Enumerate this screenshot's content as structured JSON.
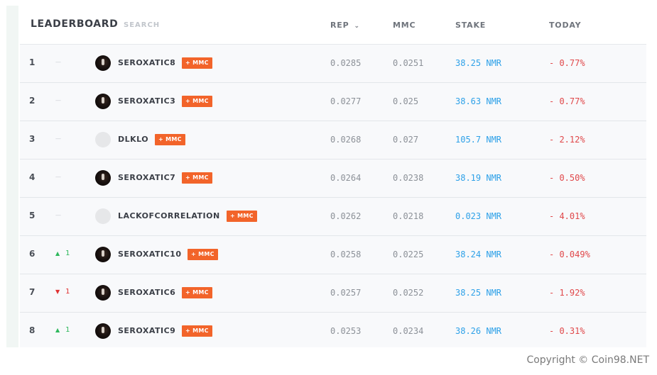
{
  "header": {
    "title": "LEADERBOARD",
    "search_placeholder": "SEARCH",
    "columns": {
      "rep": "REP",
      "mmc": "MMC",
      "stake": "STAKE",
      "today": "TODAY"
    },
    "sort_icon": "chevron-down-icon"
  },
  "colors": {
    "badge": "#f2642a",
    "stake": "#2ea1e8",
    "today_negative": "#e0484a",
    "rank_up": "#2eb85c",
    "rank_down": "#e03131"
  },
  "rows": [
    {
      "rank": "1",
      "move": "—",
      "move_dir": "none",
      "move_num": "",
      "avatar": "dark",
      "name": "SEROXATIC8",
      "badge": "+ MMC",
      "rep": "0.0285",
      "mmc": "0.0251",
      "stake": "38.25 NMR",
      "today": "- 0.77%"
    },
    {
      "rank": "2",
      "move": "—",
      "move_dir": "none",
      "move_num": "",
      "avatar": "dark",
      "name": "SEROXATIC3",
      "badge": "+ MMC",
      "rep": "0.0277",
      "mmc": "0.025",
      "stake": "38.63 NMR",
      "today": "- 0.77%"
    },
    {
      "rank": "3",
      "move": "—",
      "move_dir": "none",
      "move_num": "",
      "avatar": "light",
      "name": "DLKLO",
      "badge": "+ MMC",
      "rep": "0.0268",
      "mmc": "0.027",
      "stake": "105.7 NMR",
      "today": "- 2.12%"
    },
    {
      "rank": "4",
      "move": "—",
      "move_dir": "none",
      "move_num": "",
      "avatar": "dark",
      "name": "SEROXATIC7",
      "badge": "+ MMC",
      "rep": "0.0264",
      "mmc": "0.0238",
      "stake": "38.19 NMR",
      "today": "- 0.50%"
    },
    {
      "rank": "5",
      "move": "—",
      "move_dir": "none",
      "move_num": "",
      "avatar": "light",
      "name": "LACKOFCORRELATION",
      "badge": "+ MMC",
      "rep": "0.0262",
      "mmc": "0.0218",
      "stake": "0.023 NMR",
      "today": "- 4.01%"
    },
    {
      "rank": "6",
      "move": "▲",
      "move_dir": "up",
      "move_num": "1",
      "avatar": "dark",
      "name": "SEROXATIC10",
      "badge": "+ MMC",
      "rep": "0.0258",
      "mmc": "0.0225",
      "stake": "38.24 NMR",
      "today": "- 0.049%"
    },
    {
      "rank": "7",
      "move": "▼",
      "move_dir": "down",
      "move_num": "1",
      "avatar": "dark",
      "name": "SEROXATIC6",
      "badge": "+ MMC",
      "rep": "0.0257",
      "mmc": "0.0252",
      "stake": "38.25 NMR",
      "today": "- 1.92%"
    },
    {
      "rank": "8",
      "move": "▲",
      "move_dir": "up",
      "move_num": "1",
      "avatar": "dark",
      "name": "SEROXATIC9",
      "badge": "+ MMC",
      "rep": "0.0253",
      "mmc": "0.0234",
      "stake": "38.26 NMR",
      "today": "- 0.31%"
    }
  ],
  "footer": {
    "copyright": "Copyright © Coin98.NET"
  }
}
